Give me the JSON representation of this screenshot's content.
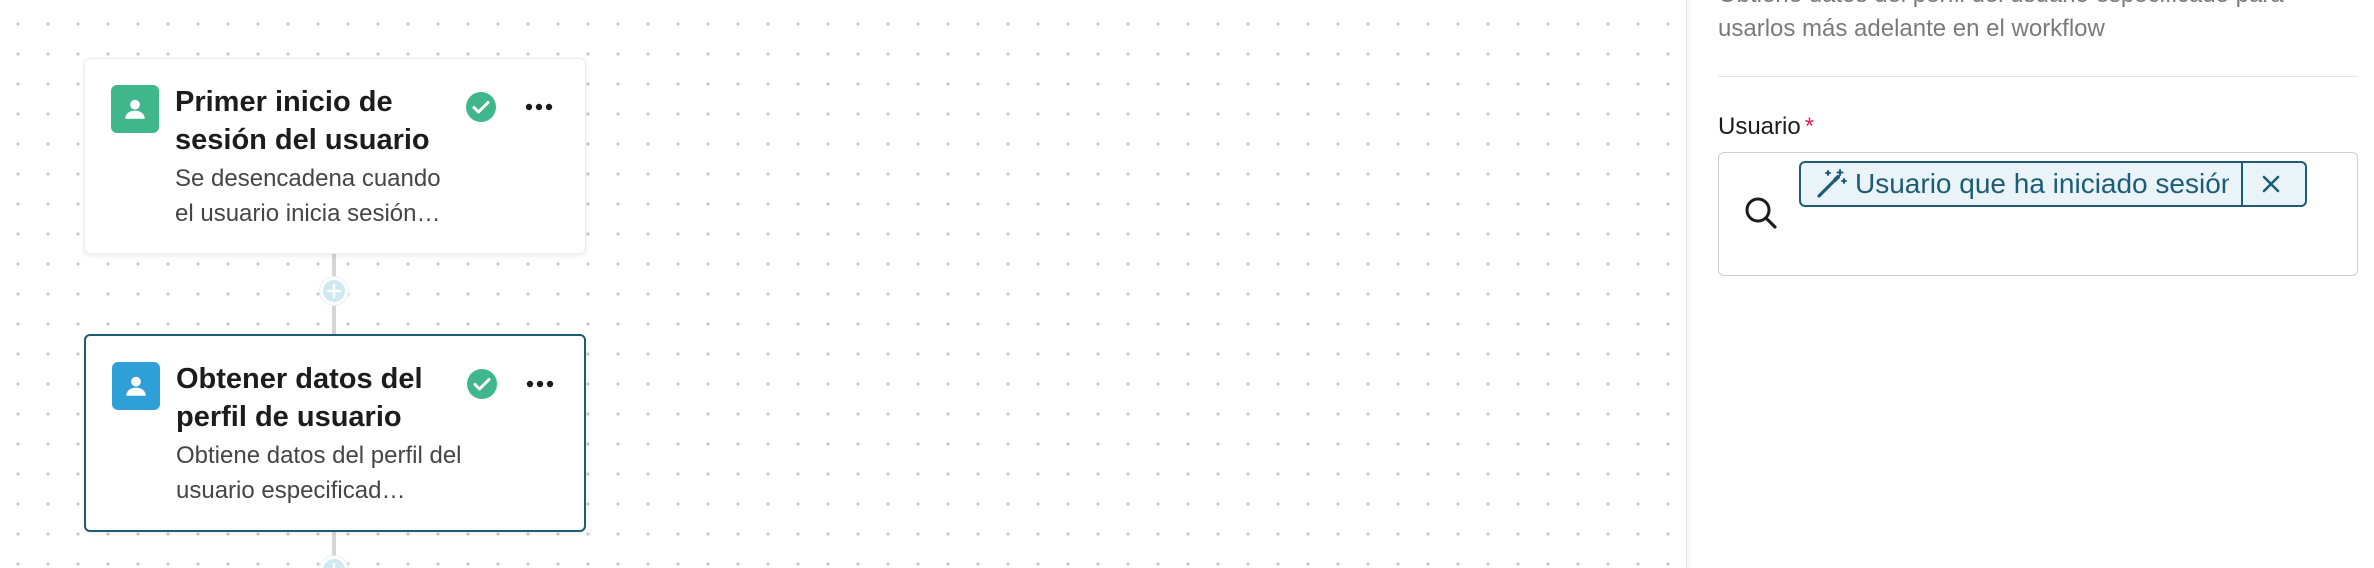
{
  "workflow": {
    "steps": [
      {
        "title": "Primer inicio de sesión del usuario",
        "description": "Se desencadena cuando el usuario inicia sesión…",
        "icon": "person-icon",
        "icon_color": "#3fb68b",
        "status": "complete"
      },
      {
        "title": "Obtener datos del perfil de usuario",
        "description": "Obtiene datos del perfil del usuario especificad…",
        "icon": "person-icon",
        "icon_color": "#2f9fd7",
        "status": "complete",
        "selected": true
      }
    ]
  },
  "panel": {
    "description": "Obtiene datos del perfil del usuario especificado para usarlos más adelante en el workflow",
    "field": {
      "label": "Usuario",
      "required_mark": "*",
      "token_text": "Usuario que ha iniciado sesión"
    }
  },
  "colors": {
    "accent": "#1d5b76",
    "success": "#3fb68b",
    "required": "#e01e5a"
  }
}
